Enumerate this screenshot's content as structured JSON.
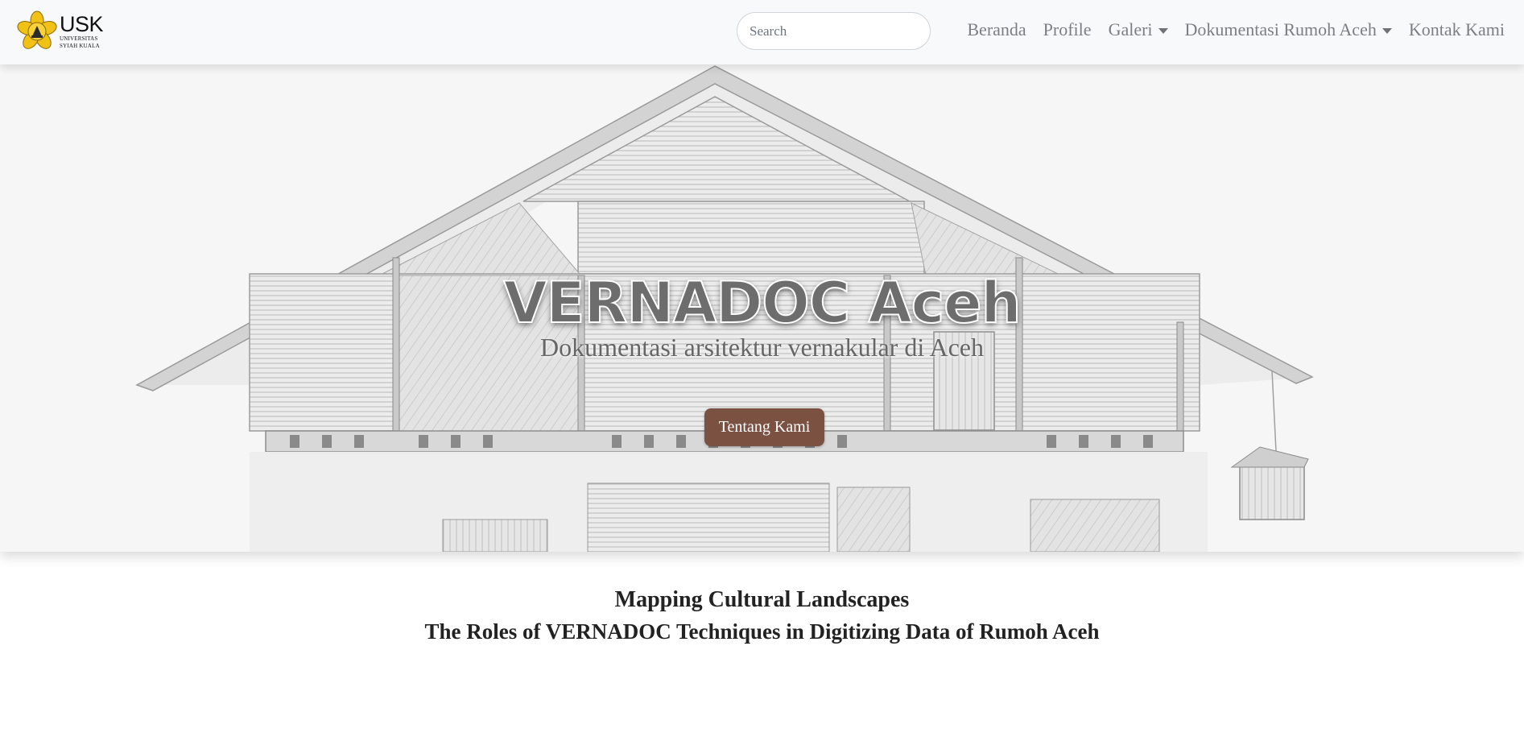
{
  "brand": {
    "name": "USK",
    "subtitle_line1": "UNIVERSITAS",
    "subtitle_line2": "SYIAH KUALA",
    "logo_color": "#f2c116",
    "logo_icon": "university-emblem-icon"
  },
  "search": {
    "placeholder": "Search",
    "value": ""
  },
  "nav": {
    "items": [
      {
        "label": "Beranda",
        "dropdown": false
      },
      {
        "label": "Profile",
        "dropdown": false
      },
      {
        "label": "Galeri",
        "dropdown": true
      },
      {
        "label": "Dokumentasi Rumoh Aceh",
        "dropdown": true
      },
      {
        "label": "Kontak Kami",
        "dropdown": false
      }
    ]
  },
  "hero": {
    "title": "VERNADOC Aceh",
    "subtitle": "Dokumentasi arsitektur vernakular di Aceh",
    "button_label": "Tentang Kami",
    "button_color": "#7b5141"
  },
  "section": {
    "heading": "Mapping Cultural Landscapes",
    "title": "The Roles of VERNADOC Techniques in Digitizing Data of Rumoh Aceh"
  }
}
